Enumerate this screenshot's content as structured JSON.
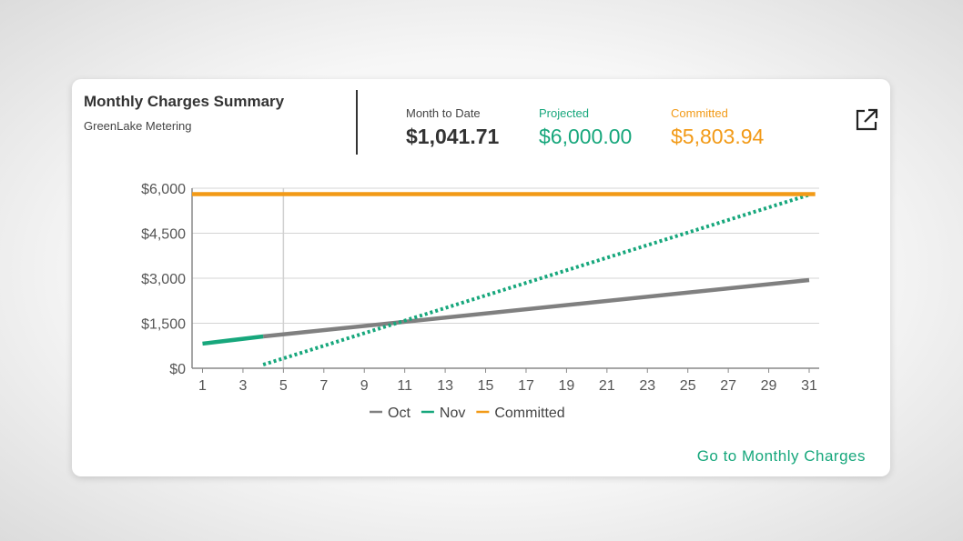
{
  "card": {
    "title": "Monthly Charges Summary",
    "subtitle": "GreenLake Metering",
    "link_label": "Go to Monthly Charges",
    "external_icon": "external-link-icon"
  },
  "metrics": {
    "month_to_date": {
      "label": "Month to Date",
      "value": "$1,041.71"
    },
    "projected": {
      "label": "Projected",
      "value": "$6,000.00",
      "color": "#17a77c"
    },
    "committed": {
      "label": "Committed",
      "value": "$5,803.94",
      "color": "#f29a17"
    }
  },
  "chart_data": {
    "type": "line",
    "title": "",
    "xlabel": "",
    "ylabel": "",
    "xlim": [
      1,
      31
    ],
    "ylim": [
      0,
      6000
    ],
    "x_ticks": [
      "1",
      "3",
      "5",
      "7",
      "9",
      "11",
      "13",
      "15",
      "17",
      "19",
      "21",
      "23",
      "25",
      "27",
      "29",
      "31"
    ],
    "y_ticks": [
      "$0",
      "$1,500",
      "$3,000",
      "$4,500",
      "$6,000"
    ],
    "marker_day": 5,
    "grid": true,
    "legend_position": "bottom",
    "series": [
      {
        "name": "Oct",
        "color": "#808080",
        "style": "solid",
        "x": [
          4,
          31
        ],
        "values": [
          1060,
          2940
        ]
      },
      {
        "name": "Nov",
        "color": "#17a77c",
        "style": "solid",
        "x": [
          1,
          4
        ],
        "values": [
          820,
          1060
        ]
      },
      {
        "name": "",
        "color": "#17a77c",
        "style": "dotted",
        "x": [
          4,
          31
        ],
        "values": [
          120,
          5780
        ]
      },
      {
        "name": "Committed",
        "color": "#f29a17",
        "style": "solid",
        "x": [
          0,
          31.3
        ],
        "values": [
          5803.94,
          5803.94
        ]
      }
    ]
  }
}
